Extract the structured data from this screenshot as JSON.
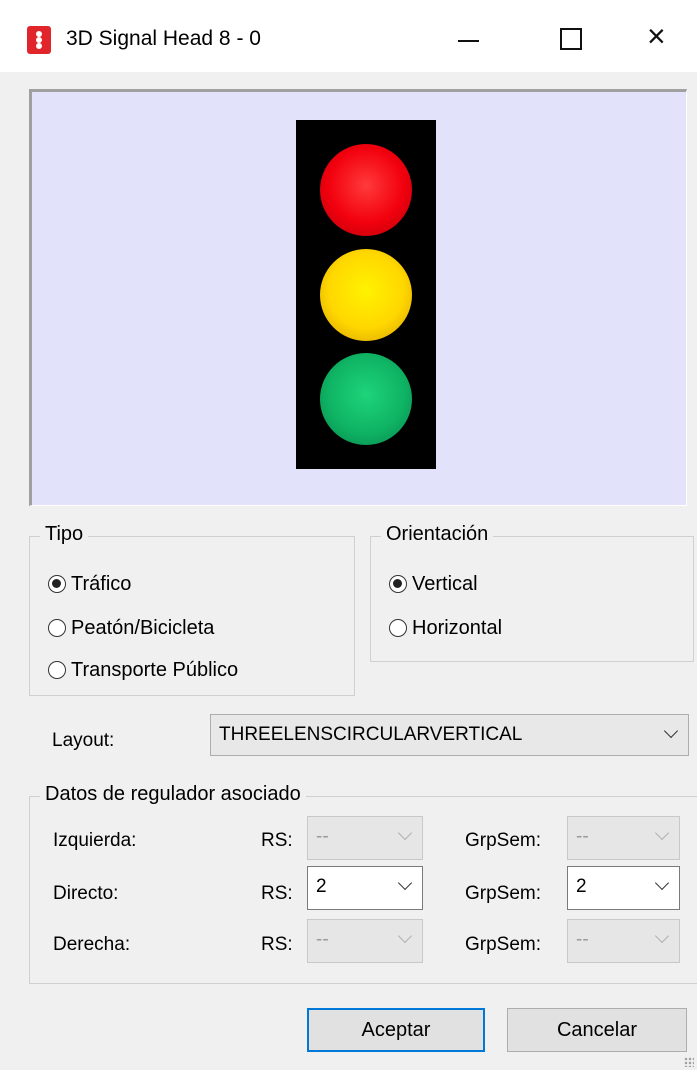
{
  "window": {
    "title": "3D Signal Head 8 - 0"
  },
  "tipo": {
    "legend": "Tipo",
    "options": [
      "Tráfico",
      "Peatón/Bicicleta",
      "Transporte Público"
    ],
    "selected": "Tráfico"
  },
  "orientacion": {
    "legend": "Orientación",
    "options": [
      "Vertical",
      "Horizontal"
    ],
    "selected": "Vertical"
  },
  "layout": {
    "label": "Layout:",
    "value": "THREELENSCIRCULARVERTICAL"
  },
  "regulador": {
    "legend": "Datos de regulador asociado",
    "rs_label": "RS:",
    "grpsem_label": "GrpSem:",
    "rows": [
      {
        "label": "Izquierda:",
        "rs": "--",
        "grpsem": "--",
        "enabled": false
      },
      {
        "label": "Directo:",
        "rs": "2",
        "grpsem": "2",
        "enabled": true
      },
      {
        "label": "Derecha:",
        "rs": "--",
        "grpsem": "--",
        "enabled": false
      }
    ]
  },
  "buttons": {
    "accept": "Aceptar",
    "cancel": "Cancelar"
  },
  "signal_lights": [
    "red",
    "yellow",
    "green"
  ],
  "colors": {
    "preview_bg": "#e2e2fa",
    "red": "#f2000e",
    "yellow": "#ffd700",
    "green": "#0fb464",
    "focus": "#0078d7"
  }
}
